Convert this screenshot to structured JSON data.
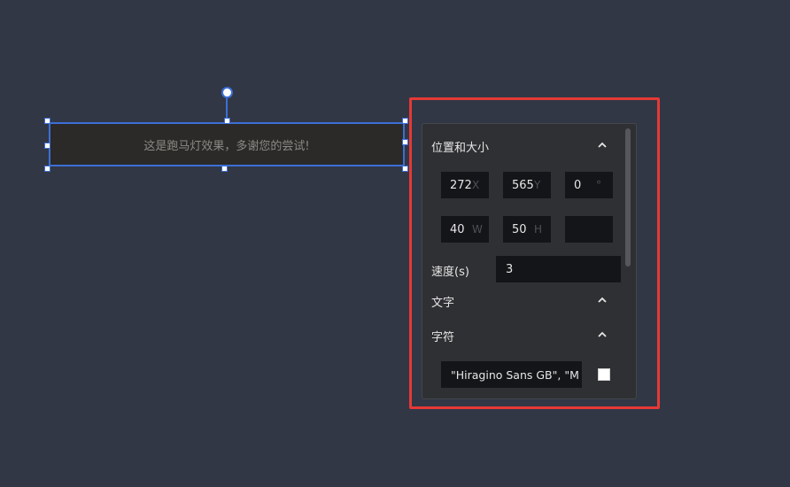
{
  "canvas": {
    "marquee_text": "这是跑马灯效果，多谢您的尝试!"
  },
  "panel": {
    "position_size": {
      "title": "位置和大小",
      "x": {
        "value": "272",
        "unit": "X"
      },
      "y": {
        "value": "565",
        "unit": "Y"
      },
      "rotation": {
        "value": "0",
        "unit": "°"
      },
      "w": {
        "value": "40",
        "unit": "W"
      },
      "h": {
        "value": "50",
        "unit": "H"
      },
      "extra": {
        "value": "",
        "unit": ""
      }
    },
    "speed": {
      "label": "速度(s)",
      "value": "3"
    },
    "text_section": {
      "title": "文字"
    },
    "char_section": {
      "title": "字符",
      "font_value": "\"Hiragino Sans GB\", \"M",
      "color": "#ffffff"
    }
  },
  "colors": {
    "background": "#323746",
    "selection": "#3b6fd6",
    "highlight": "#e53935",
    "panel": "#2f3033",
    "input": "#141518"
  },
  "icons": {
    "collapse": "chevron-up-icon"
  }
}
